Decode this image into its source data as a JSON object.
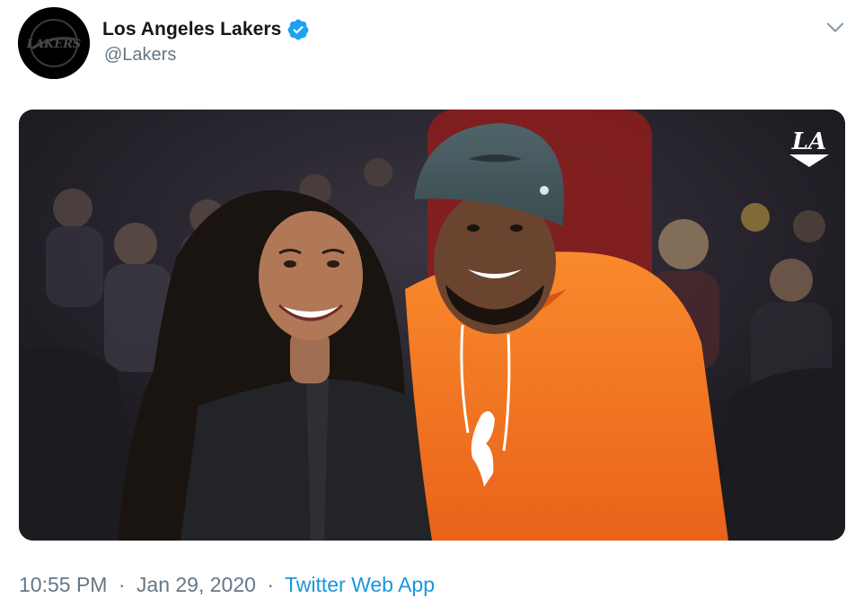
{
  "account": {
    "avatar_logo_text": "LAKERS",
    "display_name": "Los Angeles Lakers",
    "handle": "@Lakers",
    "verified": true
  },
  "icons": {
    "verified": "verified-badge-icon",
    "menu": "chevron-down-icon"
  },
  "media": {
    "watermark": "LA"
  },
  "meta": {
    "time": "10:55 PM",
    "separator": "·",
    "date": "Jan 29, 2020",
    "source": "Twitter Web App"
  },
  "colors": {
    "link": "#1b95e0",
    "muted": "#657786",
    "verified": "#1da1f2",
    "hoodie": "#f2741d"
  }
}
